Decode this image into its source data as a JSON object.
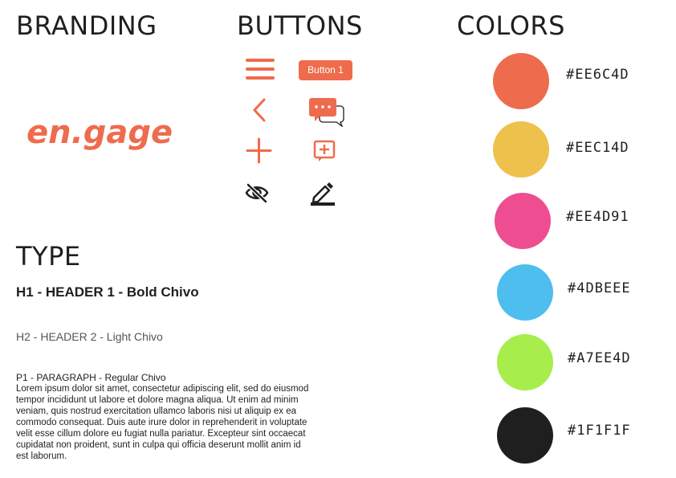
{
  "sections": {
    "branding": "BRANDING",
    "buttons": "BUTTONS",
    "colors": "COLORS",
    "type": "TYPE"
  },
  "logo": {
    "text": "en.gage"
  },
  "buttons": {
    "button1_label": "Button 1",
    "icons": [
      "hamburger-menu-icon",
      "chevron-left-icon",
      "plus-icon",
      "eye-off-icon",
      "chat-bubbles-icon",
      "add-box-icon",
      "edit-pencil-icon"
    ]
  },
  "colors": [
    {
      "hex": "#EE6C4D",
      "label": "#EE6C4D"
    },
    {
      "hex": "#EEC14D",
      "label": "#EEC14D"
    },
    {
      "hex": "#EE4D91",
      "label": "#EE4D91"
    },
    {
      "hex": "#4DBEEE",
      "label": "#4DBEEE"
    },
    {
      "hex": "#A7EE4D",
      "label": "#A7EE4D"
    },
    {
      "hex": "#1F1F1F",
      "label": "#1F1F1F"
    }
  ],
  "type": {
    "h1": "H1 - HEADER 1 - Bold Chivo",
    "h2": "H2 - HEADER 2 - Light Chivo",
    "p1": "P1 - PARAGRAPH - Regular Chivo",
    "paragraph": "Lorem ipsum dolor sit amet, consectetur adipiscing elit, sed do eiusmod tempor incididunt ut labore et dolore magna aliqua. Ut enim ad minim veniam, quis nostrud exercitation ullamco laboris nisi ut aliquip ex ea commodo consequat. Duis aute irure dolor in reprehenderit in voluptate velit esse cillum dolore eu fugiat nulla pariatur. Excepteur sint occaecat cupidatat non proident, sunt in culpa qui officia deserunt mollit anim id est laborum."
  }
}
